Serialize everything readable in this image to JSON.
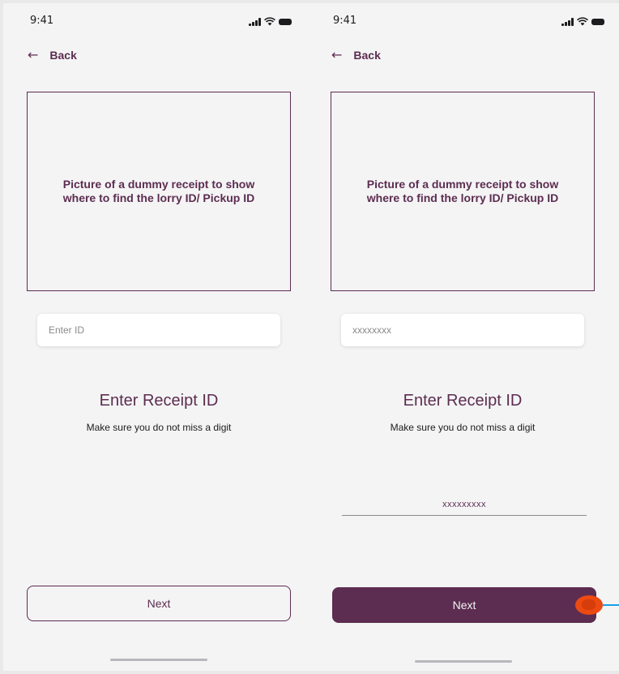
{
  "screens": [
    {
      "status_time": "9:41",
      "back_label": "Back",
      "image_placeholder": "Picture of a dummy receipt to show where to find the lorry ID/ Pickup ID",
      "input_placeholder": "Enter ID",
      "input_value": "",
      "heading": "Enter Receipt ID",
      "subheading": "Make sure you do not miss a digit",
      "next_label": "Next"
    },
    {
      "status_time": "9:41",
      "back_label": "Back",
      "image_placeholder": "Picture of a dummy receipt to show where to find the lorry ID/ Pickup ID",
      "input_placeholder": "xxxxxxxx",
      "input_value": "",
      "heading": "Enter Receipt ID",
      "subheading": "Make sure you do not miss a digit",
      "entered_id": "xxxxxxxxx",
      "next_label": "Next"
    }
  ],
  "colors": {
    "brand": "#5c2d50",
    "background": "#f4f4f5",
    "hotspot": "#ec4a12",
    "link": "#19a0e6"
  },
  "icons": {
    "back": "arrow-left-icon",
    "signal": "cellular-signal-icon",
    "wifi": "wifi-icon",
    "battery": "battery-icon"
  }
}
